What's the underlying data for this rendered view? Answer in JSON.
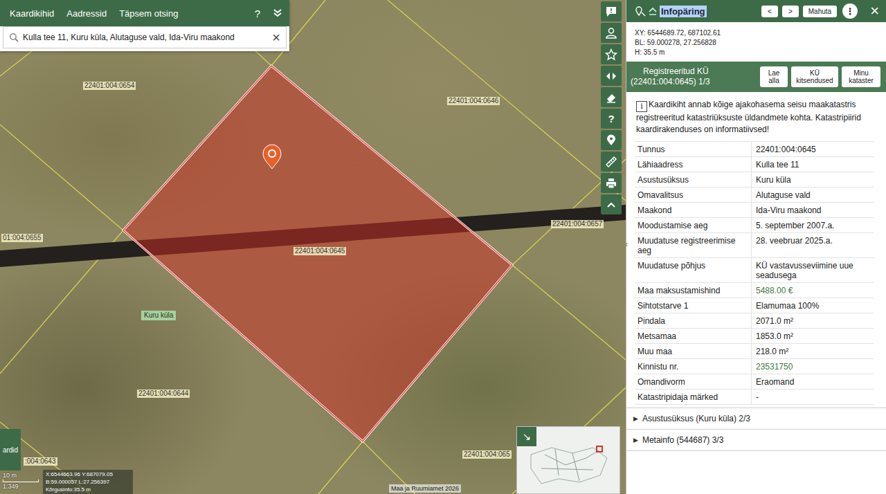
{
  "search_panel": {
    "tabs": [
      {
        "label": "Kaardikihid",
        "selected": false
      },
      {
        "label": "Aadressid",
        "selected": false
      },
      {
        "label": "Täpsem otsing",
        "selected": false
      }
    ],
    "help": "?",
    "query": "Kulla tee 11, Kuru küla, Alutaguse vald, Ida-Viru maakond",
    "clear": "×"
  },
  "map": {
    "labels": [
      {
        "text": "22401:004:0654",
        "kind": "cadastre"
      },
      {
        "text": "22401:004:0646",
        "kind": "cadastre"
      },
      {
        "text": "01:004:0655",
        "kind": "cadastre"
      },
      {
        "text": "22401:004:0657",
        "kind": "cadastre"
      },
      {
        "text": "22401:004:0645",
        "kind": "cadastre"
      },
      {
        "text": "22401:004:0644",
        "kind": "cadastre"
      },
      {
        "text": ":004:0643",
        "kind": "cadastre"
      },
      {
        "text": "22401:004:065",
        "kind": "cadastre"
      },
      {
        "text": "Kuru küla",
        "kind": "village"
      }
    ],
    "selected_parcel": {
      "highlighted": true
    },
    "toolbar_help": "?",
    "layers_button": "ardid",
    "scale": {
      "distance": "10 m",
      "ratio": "1:349"
    },
    "cursor_info": [
      "X:6544663.96 Y:687079.05",
      "B:59.000057 L:27.256397",
      "Kõrgusinfo:35.5 m"
    ],
    "attribution": "Maa ja Ruumiamet 2026",
    "minimap_toggle": "↘"
  },
  "info_panel": {
    "title": "Infopäring",
    "title_selected": true,
    "nav": {
      "prev": "<",
      "next": ">",
      "fit": "Mahuta",
      "more": "⋮",
      "close": "×"
    },
    "coordinates": [
      "XY: 6544689.72, 687102.61",
      "BL: 59.000278, 27.256828",
      "H: 35.5 m"
    ],
    "section": {
      "title": "Registreeritud KÜ",
      "subtitle": "(22401:004:0645) 1/3",
      "buttons": [
        "Lae alla",
        "KÜ kitsendused",
        "Minu kataster"
      ]
    },
    "notice": {
      "icon": "i",
      "text": "Kaardikiht annab kõige ajakohasema seisu maakatastris registreeritud katastriüksuste üldandmete kohta. Katastripiirid kaardirakenduses on informatiivsed!"
    },
    "rows": [
      {
        "label": "Tunnus",
        "value": "22401:004:0645",
        "link": false
      },
      {
        "label": "Lähiaadress",
        "value": "Kulla tee 11",
        "link": false
      },
      {
        "label": "Asustusüksus",
        "value": "Kuru küla",
        "link": false
      },
      {
        "label": "Omavalitsus",
        "value": "Alutaguse vald",
        "link": false
      },
      {
        "label": "Maakond",
        "value": "Ida-Viru maakond",
        "link": false
      },
      {
        "label": "Moodustamise aeg",
        "value": "5. september 2007.a.",
        "link": false
      },
      {
        "label": "Muudatuse registreerimise aeg",
        "value": "28. veebruar 2025.a.",
        "link": false
      },
      {
        "label": "Muudatuse põhjus",
        "value": "KÜ vastavusseviimine uue seadusega",
        "link": false
      },
      {
        "label": "Maa maksustamishind",
        "value": "5488.00 €",
        "link": true
      },
      {
        "label": "Sihtotstarve 1",
        "value": "Elamumaa 100%",
        "link": false
      },
      {
        "label": "Pindala",
        "value": "2071.0 m²",
        "link": false
      },
      {
        "label": "Metsamaa",
        "value": "1853.0 m²",
        "link": false
      },
      {
        "label": "Muu maa",
        "value": "218.0 m²",
        "link": false
      },
      {
        "label": "Kinnistu nr.",
        "value": "23531750",
        "link": true
      },
      {
        "label": "Omandivorm",
        "value": "Eraomand",
        "link": false
      },
      {
        "label": "Katastripidaja märked",
        "value": "-",
        "link": false
      }
    ],
    "collapsed": [
      {
        "arrow": "▶",
        "label": "Asustusüksus (Kuru küla) 2/3",
        "expanded": false
      },
      {
        "arrow": "▶",
        "label": "Metainfo (544687) 3/3",
        "expanded": false
      }
    ],
    "collapse_handle": "‹"
  }
}
